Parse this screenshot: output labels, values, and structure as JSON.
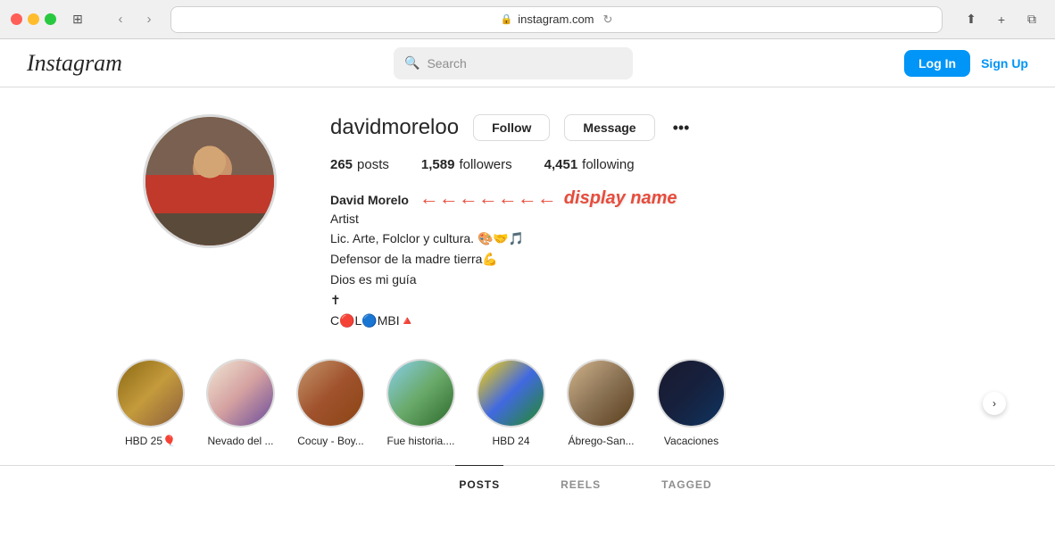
{
  "browser": {
    "url": "instagram.com",
    "tab_icon": "🔒"
  },
  "header": {
    "logo": "Instagram",
    "search_placeholder": "Search",
    "search_icon": "🔍",
    "login_label": "Log In",
    "signup_label": "Sign Up"
  },
  "profile": {
    "username": "davidmoreloo",
    "follow_label": "Follow",
    "message_label": "Message",
    "more_icon": "•••",
    "stats": {
      "posts_count": "265",
      "posts_label": "posts",
      "followers_count": "1,589",
      "followers_label": "followers",
      "following_count": "4,451",
      "following_label": "following"
    },
    "bio": {
      "name": "David Morelo",
      "title": "Artist",
      "line1": "Lic. Arte, Folclor y cultura. 🎨🤝🎵",
      "line2": "Defensor de la madre tierra💪",
      "line3": "Dios es mi guía",
      "line4": "✝",
      "line5": "C🔴L🔵MBI🔺"
    },
    "annotation": {
      "arrow": "←",
      "text": "display name"
    }
  },
  "stories": [
    {
      "label": "HBD 25🎈",
      "color_class": "story-1"
    },
    {
      "label": "Nevado del ...",
      "color_class": "story-2"
    },
    {
      "label": "Cocuy - Boy...",
      "color_class": "story-3"
    },
    {
      "label": "Fue historia....",
      "color_class": "story-4"
    },
    {
      "label": "HBD 24",
      "color_class": "story-5"
    },
    {
      "label": "Ábrego-San...",
      "color_class": "story-6"
    },
    {
      "label": "Vacaciones",
      "color_class": "story-7"
    }
  ],
  "tabs": [
    {
      "label": "POSTS",
      "active": true
    },
    {
      "label": "REELS",
      "active": false
    },
    {
      "label": "TAGGED",
      "active": false
    }
  ]
}
